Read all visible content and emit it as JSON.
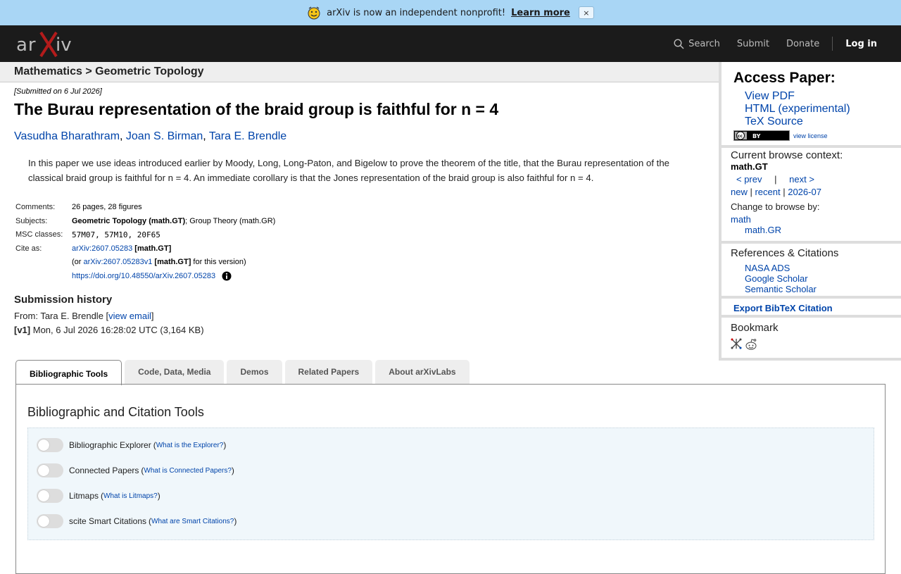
{
  "banner": {
    "message": "arXiv is now an independent nonprofit!",
    "learn_more": "Learn more",
    "close": "×"
  },
  "header": {
    "logo_text": "arXiv",
    "nav": {
      "search": "Search",
      "submit": "Submit",
      "donate": "Donate",
      "login": "Log in"
    }
  },
  "breadcrumb": "Mathematics > Geometric Topology",
  "paper": {
    "submitted": "[Submitted on 6 Jul 2026]",
    "title": "The Burau representation of the braid group is faithful for n = 4",
    "authors": [
      "Vasudha Bharathram",
      "Joan S. Birman",
      "Tara E. Brendle"
    ],
    "abstract": "In this paper we use ideas introduced earlier by Moody, Long, Long-Paton, and Bigelow to prove the theorem of the title, that the Burau representation of the classical braid group is faithful for n = 4. An immediate corollary is that the Jones representation of the braid group is also faithful for n = 4."
  },
  "metadata": {
    "comments_label": "Comments:",
    "comments": "26 pages, 28 figures",
    "subjects_label": "Subjects:",
    "subject_primary": "Geometric Topology (math.GT)",
    "subject_secondary": "; Group Theory (math.GR)",
    "msc_abbr": "MSC",
    "msc_label": " classes:",
    "msc": "57M07, 57M10, 20F65",
    "cite_label": "Cite as:",
    "cite_id": "arXiv:2607.05283",
    "cite_class": "[math.GT]",
    "version_prefix": "(or ",
    "version_id": "arXiv:2607.05283v1",
    "version_class": "[math.GT]",
    "version_suffix": " for this version)",
    "doi": "https://doi.org/10.48550/arXiv.2607.05283"
  },
  "history": {
    "heading": "Submission history",
    "from_prefix": "From: Tara E. Brendle [",
    "view_email": "view email",
    "from_suffix": "]",
    "v1_label": "[v1]",
    "v1_text": " Mon, 6 Jul 2026 16:28:02 UTC (3,164 KB)"
  },
  "sidebar": {
    "access_heading": "Access Paper:",
    "access_links": [
      "View PDF",
      "HTML (experimental)",
      "TeX Source"
    ],
    "license_badge": "cc BY",
    "view_license": "view license",
    "context_heading": "Current browse context:",
    "context": "math.GT",
    "prev": "< prev",
    "nav_sep": "|",
    "next": "next >",
    "new": "new",
    "recent": "recent",
    "month": "2026-07",
    "link_sep": " | ",
    "change_heading": "Change to browse by:",
    "change_1": "math",
    "change_2": "math.GR",
    "refs_heading": "References & Citations",
    "refs": [
      "NASA ADS",
      "Google Scholar",
      "Semantic Scholar"
    ],
    "export": "Export BibTeX Citation",
    "bookmark_heading": "Bookmark"
  },
  "tabs": [
    "Bibliographic Tools",
    "Code, Data, Media",
    "Demos",
    "Related Papers",
    "About arXivLabs"
  ],
  "tools": {
    "heading": "Bibliographic and Citation Tools",
    "open_paren": "(",
    "close_paren": ")",
    "items": [
      {
        "label": "Bibliographic Explorer",
        "help": "What is the Explorer?"
      },
      {
        "label": "Connected Papers",
        "help": "What is Connected Papers?"
      },
      {
        "label": "Litmaps",
        "help": "What is Litmaps?"
      },
      {
        "label": "scite Smart Citations",
        "help": "What are Smart Citations?"
      }
    ]
  },
  "colors": {
    "banner_bg": "#a9d6f5",
    "header_bg": "#1b1b1b",
    "link": "#0044aa",
    "logo_accent": "#b31b1b"
  }
}
